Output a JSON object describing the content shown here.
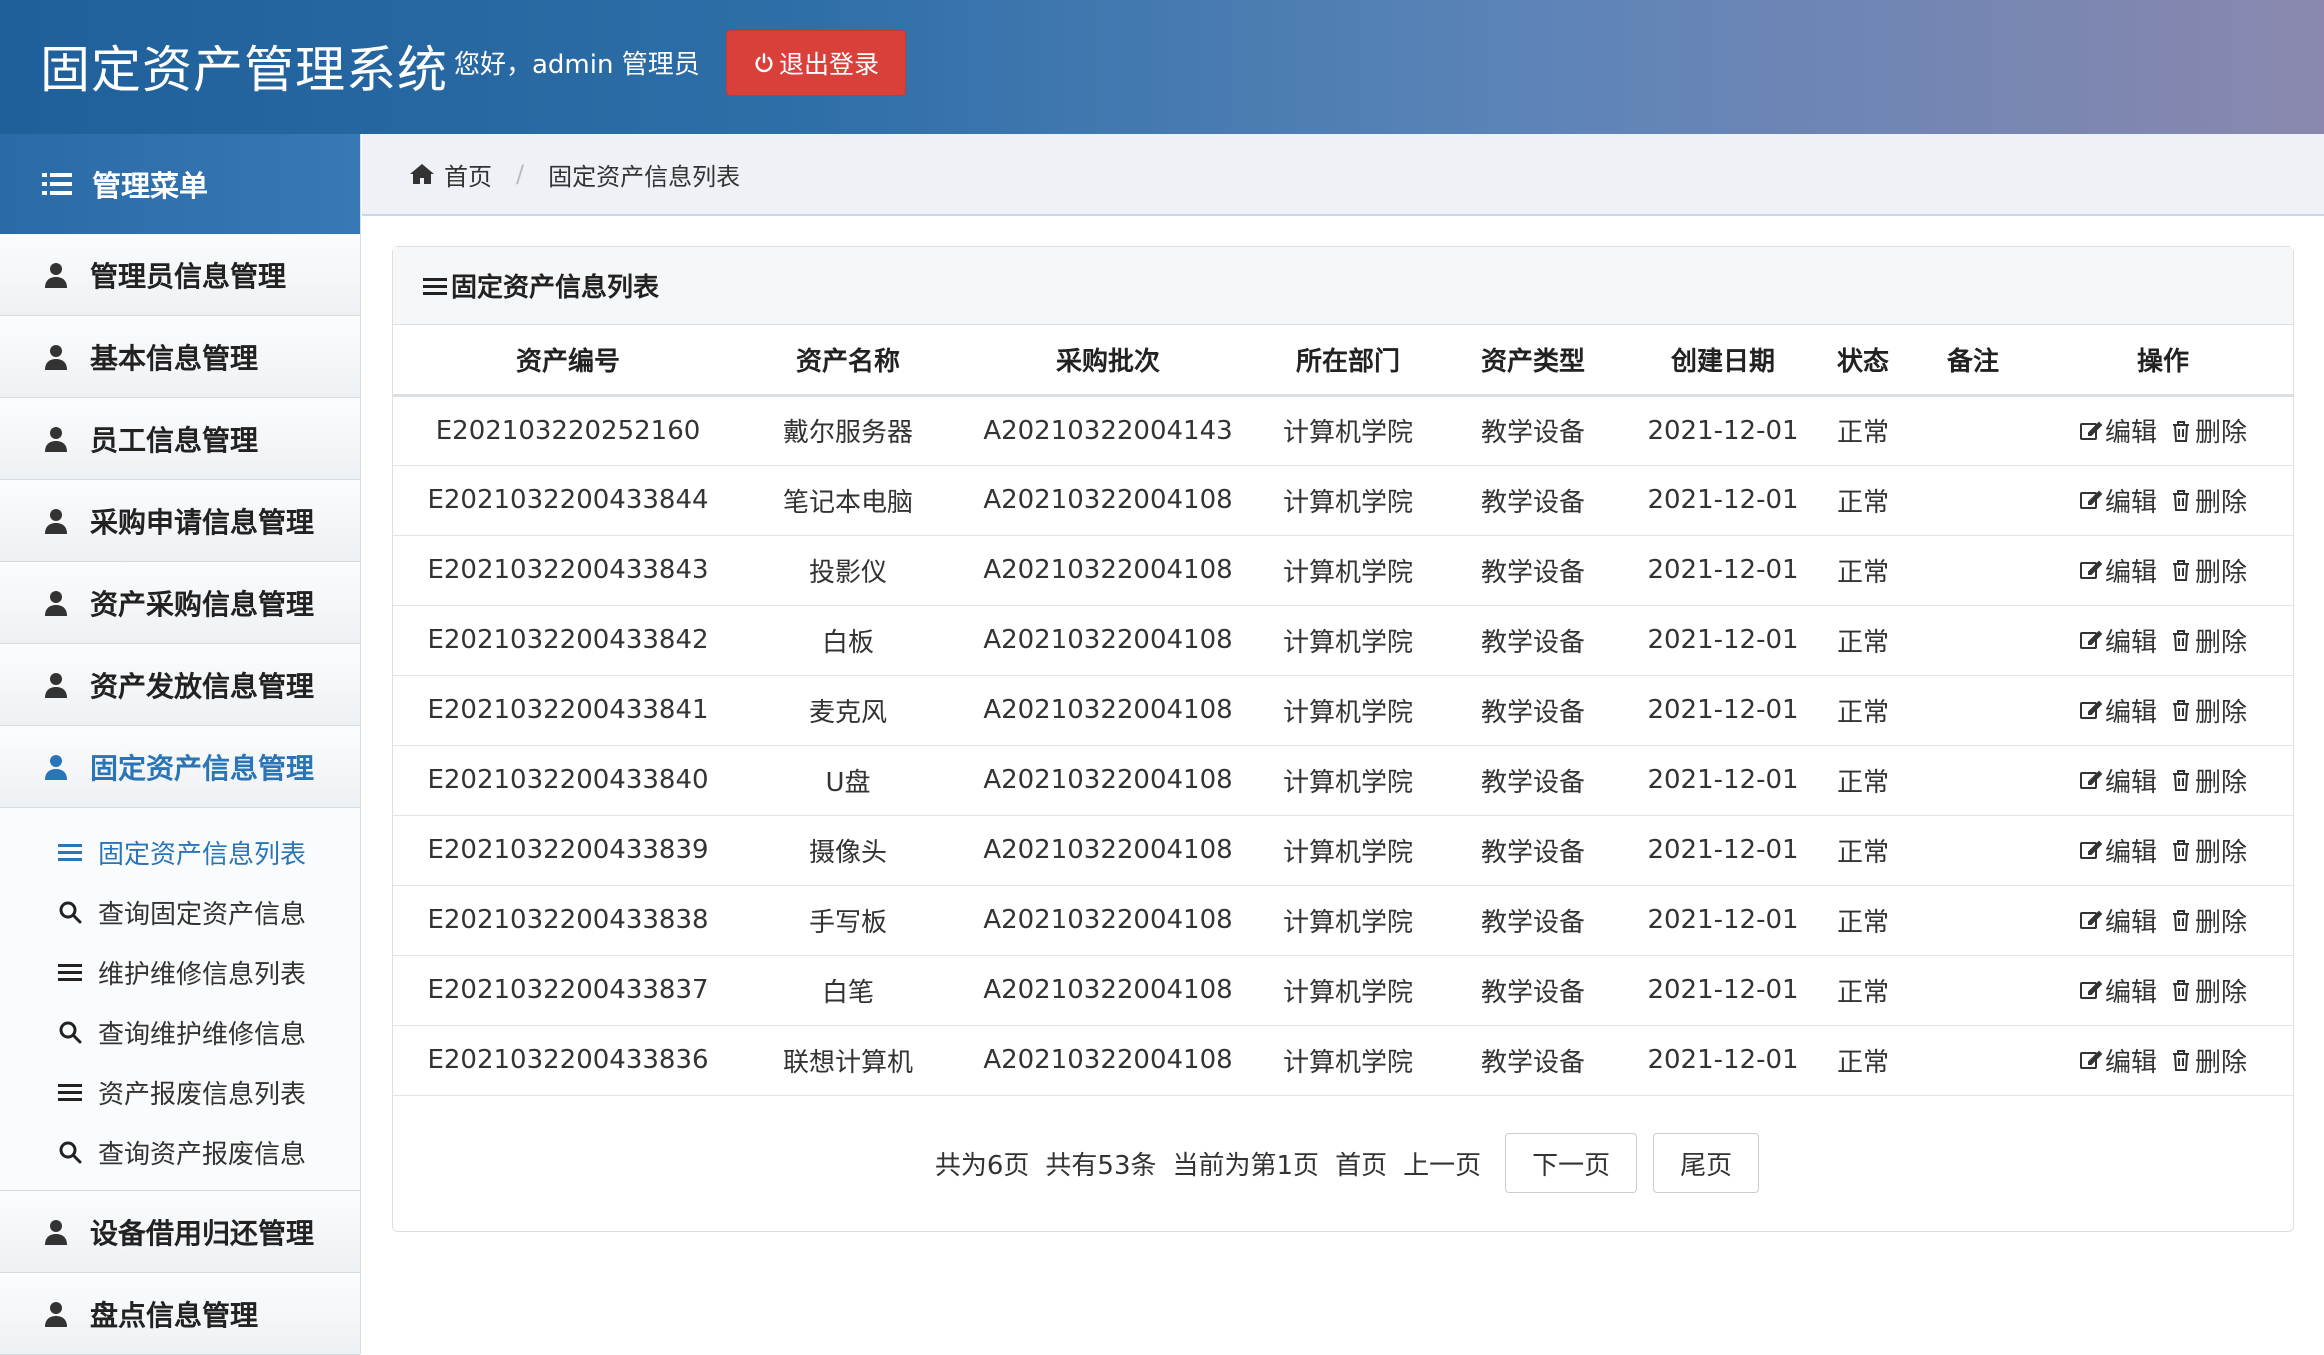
{
  "header": {
    "title": "固定资产管理系统",
    "greeting": "您好，admin 管理员",
    "logout_label": "退出登录"
  },
  "sidebar": {
    "title": "管理菜单",
    "items": [
      {
        "label": "管理员信息管理"
      },
      {
        "label": "基本信息管理"
      },
      {
        "label": "员工信息管理"
      },
      {
        "label": "采购申请信息管理"
      },
      {
        "label": "资产采购信息管理"
      },
      {
        "label": "资产发放信息管理"
      },
      {
        "label": "固定资产信息管理"
      },
      {
        "label": "设备借用归还管理"
      },
      {
        "label": "盘点信息管理"
      }
    ],
    "sub_items": [
      {
        "label": "固定资产信息列表",
        "icon": "list-icon"
      },
      {
        "label": "查询固定资产信息",
        "icon": "search-icon"
      },
      {
        "label": "维护维修信息列表",
        "icon": "list-icon"
      },
      {
        "label": "查询维护维修信息",
        "icon": "search-icon"
      },
      {
        "label": "资产报废信息列表",
        "icon": "list-icon"
      },
      {
        "label": "查询资产报废信息",
        "icon": "search-icon"
      }
    ]
  },
  "breadcrumb": {
    "home": "首页",
    "current": "固定资产信息列表"
  },
  "panel": {
    "title": "固定资产信息列表"
  },
  "table": {
    "headers": [
      "资产编号",
      "资产名称",
      "采购批次",
      "所在部门",
      "资产类型",
      "创建日期",
      "状态",
      "备注",
      "操作"
    ],
    "edit_label": "编辑",
    "delete_label": "删除",
    "rows": [
      [
        "E202103220252160",
        "戴尔服务器",
        "A20210322004143",
        "计算机学院",
        "教学设备",
        "2021-12-01",
        "正常",
        ""
      ],
      [
        "E2021032200433844",
        "笔记本电脑",
        "A20210322004108",
        "计算机学院",
        "教学设备",
        "2021-12-01",
        "正常",
        ""
      ],
      [
        "E2021032200433843",
        "投影仪",
        "A20210322004108",
        "计算机学院",
        "教学设备",
        "2021-12-01",
        "正常",
        ""
      ],
      [
        "E2021032200433842",
        "白板",
        "A20210322004108",
        "计算机学院",
        "教学设备",
        "2021-12-01",
        "正常",
        ""
      ],
      [
        "E2021032200433841",
        "麦克风",
        "A20210322004108",
        "计算机学院",
        "教学设备",
        "2021-12-01",
        "正常",
        ""
      ],
      [
        "E2021032200433840",
        "U盘",
        "A20210322004108",
        "计算机学院",
        "教学设备",
        "2021-12-01",
        "正常",
        ""
      ],
      [
        "E2021032200433839",
        "摄像头",
        "A20210322004108",
        "计算机学院",
        "教学设备",
        "2021-12-01",
        "正常",
        ""
      ],
      [
        "E2021032200433838",
        "手写板",
        "A20210322004108",
        "计算机学院",
        "教学设备",
        "2021-12-01",
        "正常",
        ""
      ],
      [
        "E2021032200433837",
        "白笔",
        "A20210322004108",
        "计算机学院",
        "教学设备",
        "2021-12-01",
        "正常",
        ""
      ],
      [
        "E2021032200433836",
        "联想计算机",
        "A20210322004108",
        "计算机学院",
        "教学设备",
        "2021-12-01",
        "正常",
        ""
      ]
    ]
  },
  "pager": {
    "total_pages": "共为6页",
    "total_records": "共有53条",
    "current_page": "当前为第1页",
    "first": "首页",
    "prev": "上一页",
    "next": "下一页",
    "last": "尾页"
  },
  "colors": {
    "accent": "#2a75b7",
    "logout": "#d9403a"
  }
}
